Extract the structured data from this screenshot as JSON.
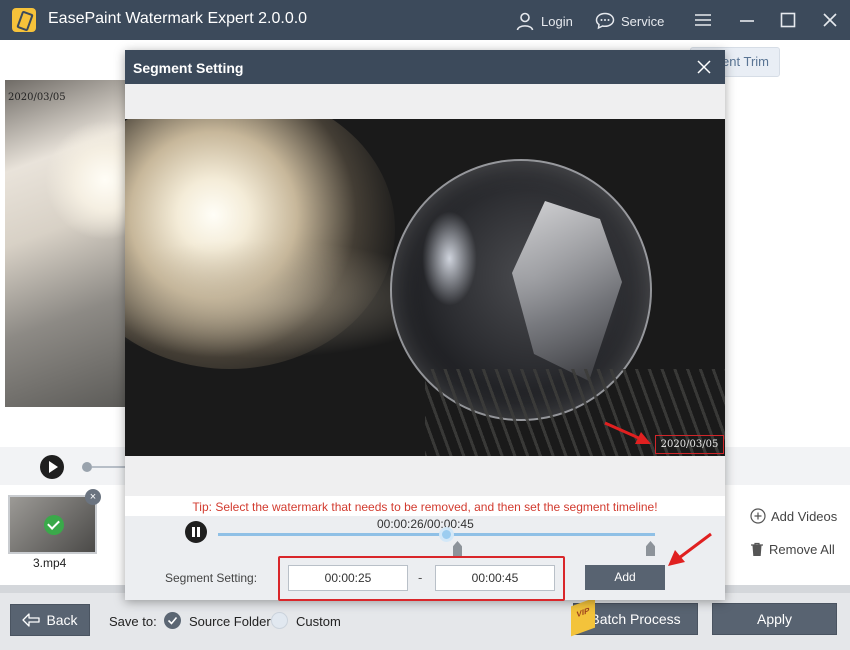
{
  "app": {
    "title": "EasePaint Watermark Expert  2.0.0.0",
    "login_label": "Login",
    "service_label": "Service"
  },
  "background": {
    "preview_date": "2020/03/05",
    "segment_trim_label": "ent Trim",
    "add_videos_label": "Add Videos",
    "remove_all_label": "Remove All",
    "thumbnail_label": "3.mp4",
    "thumbnail_close": "×"
  },
  "bottom_bar": {
    "back_label": "Back",
    "save_to_label": "Save to:",
    "source_folder_label": "Source Folder",
    "custom_label": "Custom",
    "selected_save_option": "Source Folder",
    "batch_process_label": "Batch Process",
    "vip_label": "VIP",
    "apply_label": "Apply"
  },
  "modal": {
    "title": "Segment Setting",
    "watermark_text": "2020/03/05",
    "tip": "Tip: Select the watermark that needs to be removed, and then set the segment timeline!",
    "time_readout": "00:00:26/00:00:45",
    "segment_label": "Segment Setting:",
    "start_time": "00:00:25",
    "end_time": "00:00:45",
    "separator": "-",
    "add_label": "Add"
  },
  "colors": {
    "titlebar": "#3c4a5b",
    "accent_red": "#d9262a",
    "button_dark": "#586371",
    "track_blue": "#8fc0e6",
    "tip_red": "#d23b2f",
    "check_green": "#3aa94a"
  }
}
